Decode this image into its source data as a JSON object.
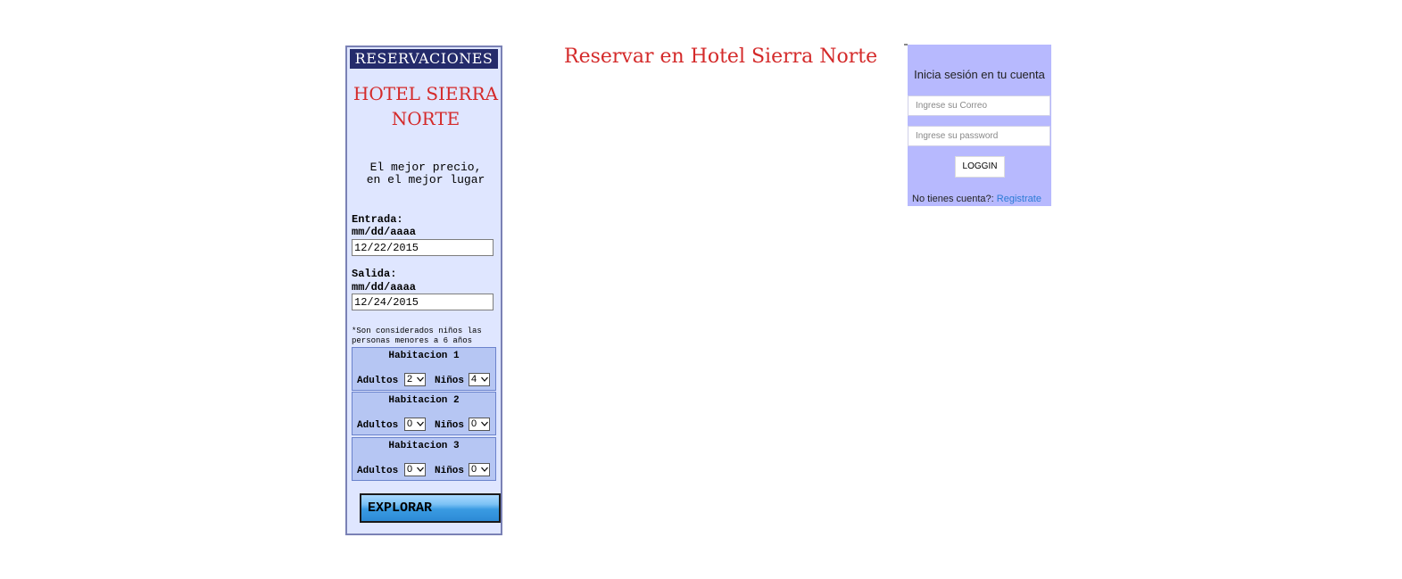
{
  "reservation": {
    "header": "RESERVACIONES",
    "hotel_name": "HOTEL SIERRA NORTE",
    "slogan_line1": "El mejor precio,",
    "slogan_line2": "en el mejor lugar",
    "checkin": {
      "label": "Entrada:",
      "format": "mm/dd/aaaa",
      "value": "12/22/2015"
    },
    "checkout": {
      "label": "Salida:",
      "format": "mm/dd/aaaa",
      "value": "12/24/2015"
    },
    "note": "*Son considerados niños las personas menores a 6 años",
    "rooms": [
      {
        "title": "Habitacion 1",
        "adults_label": "Adultos",
        "adults": "2",
        "children_label": "Niños",
        "children": "4"
      },
      {
        "title": "Habitacion 2",
        "adults_label": "Adultos",
        "adults": "0",
        "children_label": "Niños",
        "children": "0"
      },
      {
        "title": "Habitacion 3",
        "adults_label": "Adultos",
        "adults": "0",
        "children_label": "Niños",
        "children": "0"
      }
    ],
    "explore_label": "EXPLORAR"
  },
  "page": {
    "title": "Reservar en Hotel Sierra Norte"
  },
  "login": {
    "title": "Inicia sesión en tu cuenta",
    "email_placeholder": "Ingrese su Correo",
    "password_placeholder": "Ingrese su password",
    "button_label": "LOGGIN",
    "no_account_text": "No tienes cuenta?:",
    "register_link": "Registrate"
  },
  "colors": {
    "panel_bg": "#dfe6ff",
    "header_bg": "#242b6b",
    "hotel_red": "#d42a2a",
    "room_bg": "#b6c6f3",
    "login_bg": "#b7b9fe",
    "link_blue": "#2b7bd6"
  },
  "icons": {
    "select_arrow": "chevron-down-icon"
  }
}
